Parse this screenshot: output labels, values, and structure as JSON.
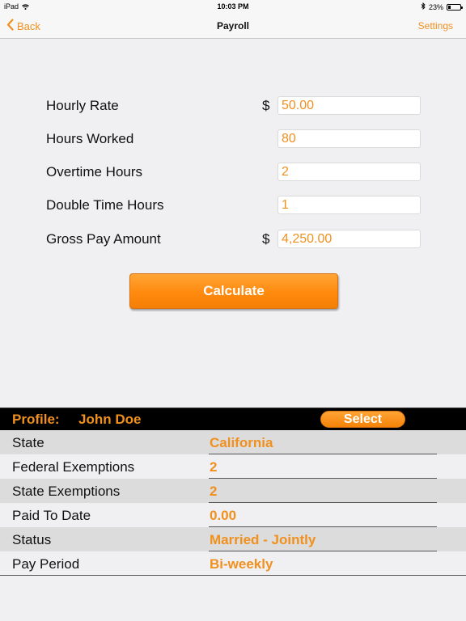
{
  "status_bar": {
    "device": "iPad",
    "time": "10:03 PM",
    "battery": "23%",
    "battery_level": 0.23,
    "icons": [
      "wifi-icon",
      "bluetooth-icon",
      "battery-icon"
    ]
  },
  "nav": {
    "back_label": "Back",
    "title": "Payroll",
    "settings_label": "Settings",
    "accent_color": "#f0901e"
  },
  "form": {
    "hourly_rate": {
      "label": "Hourly Rate",
      "currency": "$",
      "value": "50.00"
    },
    "hours_worked": {
      "label": "Hours Worked",
      "value": "80"
    },
    "overtime_hours": {
      "label": "Overtime Hours",
      "value": "2"
    },
    "double_time_hours": {
      "label": "Double Time Hours",
      "value": "1"
    },
    "gross_pay": {
      "label": "Gross Pay Amount",
      "currency": "$",
      "value": "4,250.00"
    },
    "calculate_label": "Calculate"
  },
  "profile": {
    "label": "Profile:",
    "name": "John Doe",
    "select_label": "Select",
    "rows": [
      {
        "label": "State",
        "value": "California"
      },
      {
        "label": "Federal Exemptions",
        "value": "2"
      },
      {
        "label": "State Exemptions",
        "value": "2"
      },
      {
        "label": "Paid To Date",
        "value": "0.00"
      },
      {
        "label": "Status",
        "value": "Married - Jointly"
      },
      {
        "label": "Pay Period",
        "value": "Bi-weekly"
      }
    ]
  }
}
